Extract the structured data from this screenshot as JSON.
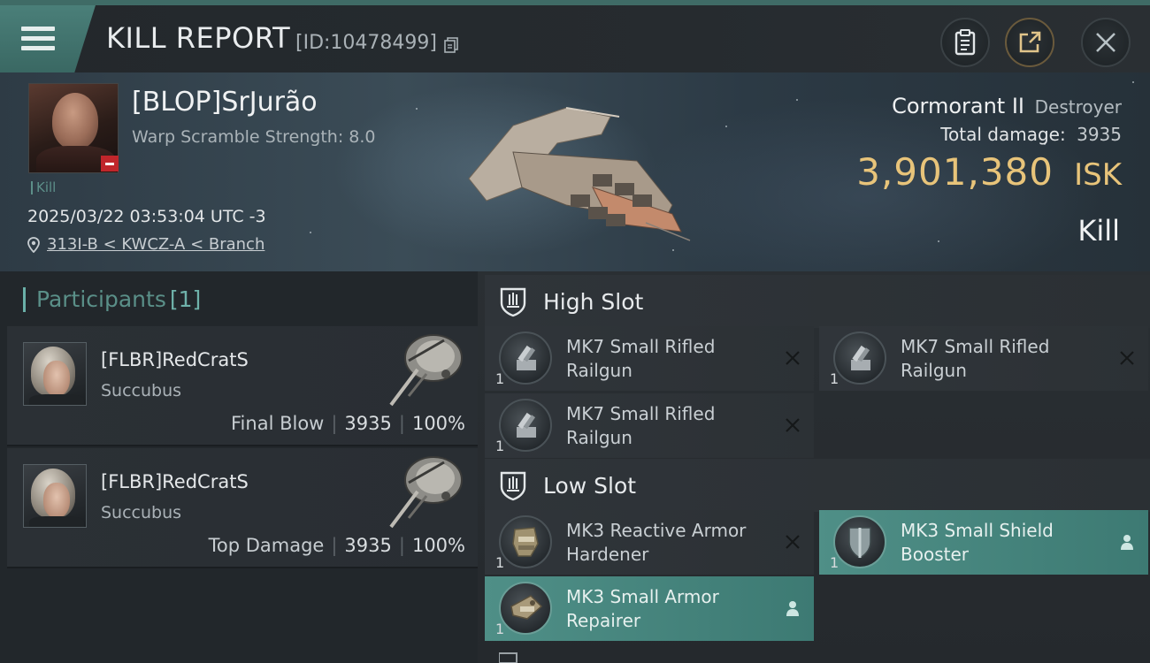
{
  "header": {
    "title": "KILL REPORT",
    "report_id": "[ID:10478499]"
  },
  "victim": {
    "name": "[BLOP]SrJurão",
    "warp_scramble": "Warp Scramble Strength: 8.0",
    "kill_tag": "Kill",
    "time": "2025/03/22 03:53:04 UTC -3",
    "location": "313I-B < KWCZ-A < Branch",
    "ship": "Cormorant II",
    "ship_class": "Destroyer",
    "total_damage_label": "Total damage:",
    "total_damage": "3935",
    "isk_value": "3,901,380",
    "isk_unit": "ISK",
    "result": "Kill"
  },
  "participants": {
    "title": "Participants",
    "count": "[1]",
    "rows": [
      {
        "name": "[FLBR]RedCratS",
        "ship": "Succubus",
        "label": "Final Blow",
        "damage": "3935",
        "percent": "100%"
      },
      {
        "name": "[FLBR]RedCratS",
        "ship": "Succubus",
        "label": "Top Damage",
        "damage": "3935",
        "percent": "100%"
      }
    ]
  },
  "modules": {
    "high_slot_label": "High Slot",
    "low_slot_label": "Low Slot",
    "high": [
      {
        "line1": "MK7 Small Rifled",
        "line2": "Railgun",
        "qty": "1",
        "status": "destroyed"
      },
      {
        "line1": "MK7 Small Rifled",
        "line2": "Railgun",
        "qty": "1",
        "status": "destroyed"
      },
      {
        "line1": "MK7 Small Rifled",
        "line2": "Railgun",
        "qty": "1",
        "status": "destroyed"
      }
    ],
    "low": [
      {
        "line1": "MK3 Reactive Armor",
        "line2": "Hardener",
        "qty": "1",
        "status": "destroyed"
      },
      {
        "line1": "MK3 Small Shield",
        "line2": "Booster",
        "qty": "1",
        "status": "dropped"
      },
      {
        "line1": "MK3 Small Armor",
        "line2": "Repairer",
        "qty": "1",
        "status": "dropped"
      }
    ]
  },
  "colors": {
    "accent": "#4f8f87",
    "isk": "#e8c47a",
    "destroyed_badge": "#c0262b"
  },
  "icons": [
    "menu-icon",
    "copy-icon",
    "clipboard-icon",
    "share-icon",
    "close-icon",
    "location-pin-icon",
    "shield-slot-icon",
    "destroyed-x-icon",
    "dropped-person-icon"
  ]
}
